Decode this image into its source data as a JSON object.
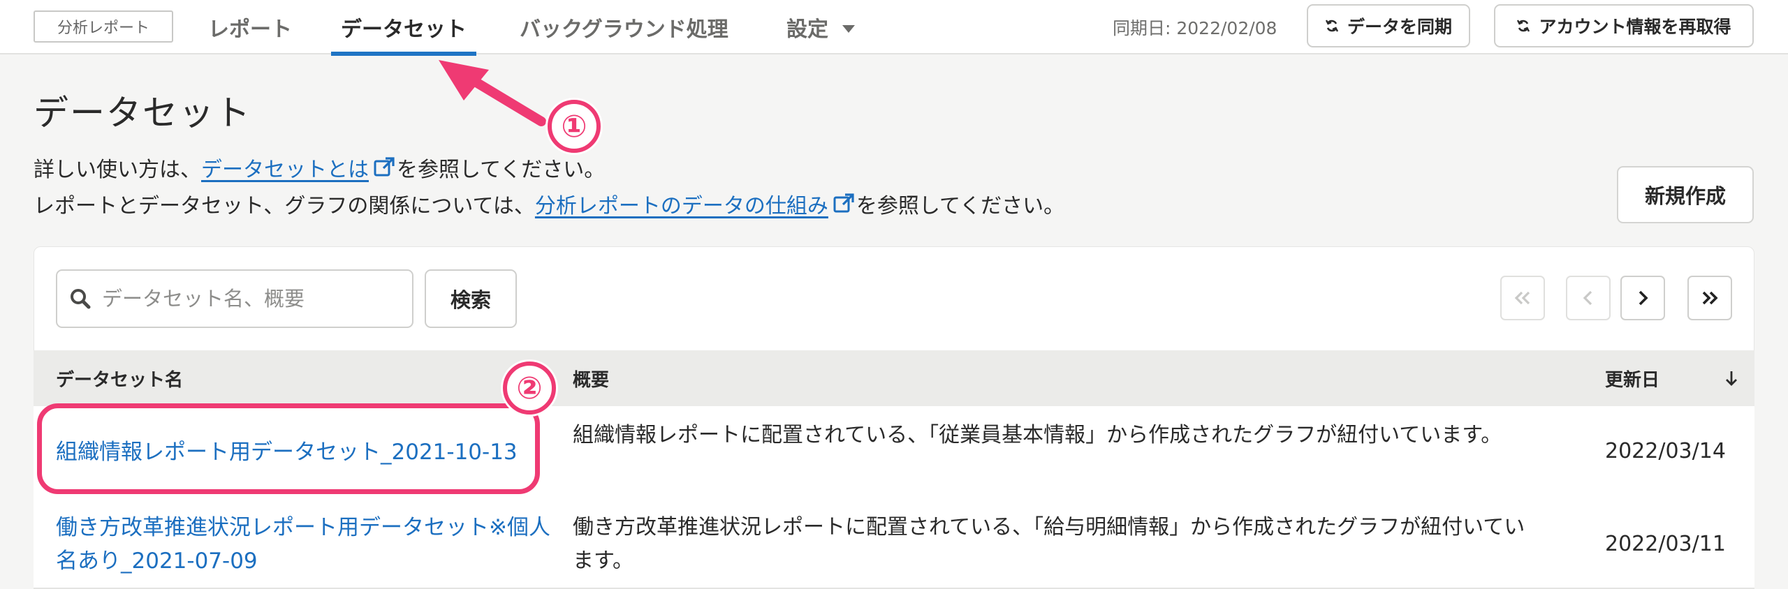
{
  "nav": {
    "brand": "分析レポート",
    "tabs": [
      {
        "label": "レポート"
      },
      {
        "label": "データセット"
      },
      {
        "label": "バックグラウンド処理"
      },
      {
        "label": "設定"
      }
    ],
    "sync_date": "同期日: 2022/02/08",
    "sync_button": "データを同期",
    "refetch_button": "アカウント情報を再取得"
  },
  "page": {
    "title": "データセット",
    "desc1_prefix": "詳しい使い方は、",
    "desc1_link": "データセットとは",
    "desc1_suffix": "を参照してください。",
    "desc2_prefix": "レポートとデータセット、グラフの関係については、",
    "desc2_link": "分析レポートのデータの仕組み",
    "desc2_suffix": "を参照してください。",
    "new_button": "新規作成"
  },
  "annotations": {
    "badge1": "①",
    "badge2": "②"
  },
  "search": {
    "placeholder": "データセット名、概要",
    "button": "検索"
  },
  "table": {
    "headers": {
      "name": "データセット名",
      "summary": "概要",
      "updated": "更新日"
    },
    "rows": [
      {
        "name": "組織情報レポート用データセット_2021-10-13",
        "summary": "組織情報レポートに配置されている、「従業員基本情報」から作成されたグラフが紐付いています。",
        "updated": "2022/03/14"
      },
      {
        "name": "働き方改革推進状況レポート用データセット※個人名あり_2021-07-09",
        "summary": "働き方改革推進状況レポートに配置されている、「給与明細情報」から作成されたグラフが紐付いています。",
        "updated": "2022/03/11"
      }
    ]
  },
  "colors": {
    "accent": "#1f74c4",
    "link": "#1c6fc0",
    "callout": "#ef3a73"
  }
}
